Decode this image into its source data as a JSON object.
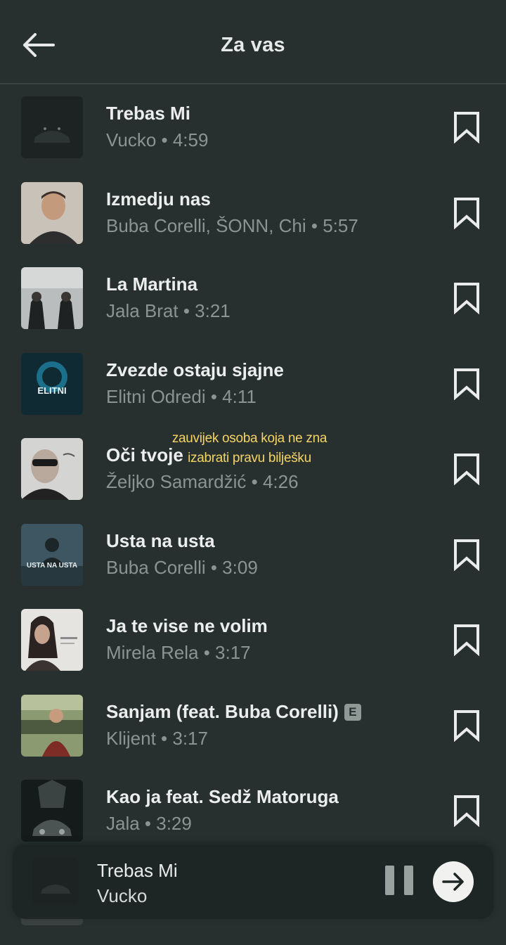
{
  "header": {
    "title": "Za vas"
  },
  "songs": [
    {
      "title": "Trebas Mi",
      "subtitle": "Vucko • 4:59",
      "explicit": false
    },
    {
      "title": "Izmedju nas",
      "subtitle": "Buba Corelli, ŠONN, Chi • 5:57",
      "explicit": false
    },
    {
      "title": "La Martina",
      "subtitle": "Jala Brat • 3:21",
      "explicit": false
    },
    {
      "title": "Zvezde ostaju sjajne",
      "subtitle": "Elitni Odredi • 4:11",
      "explicit": false
    },
    {
      "title": "Oči tvoje",
      "subtitle": "Željko Samardžić • 4:26",
      "explicit": false
    },
    {
      "title": "Usta na usta",
      "subtitle": "Buba Corelli • 3:09",
      "explicit": false
    },
    {
      "title": "Ja te vise ne volim",
      "subtitle": "Mirela Rela • 3:17",
      "explicit": false
    },
    {
      "title": "Sanjam (feat. Buba Corelli)",
      "subtitle": "Klijent • 3:17",
      "explicit": true
    },
    {
      "title": "Kao ja feat. Sedž Matoruga",
      "subtitle": "Jala • 3:29",
      "explicit": false
    }
  ],
  "explicit_label": "E",
  "overlay": {
    "line1": "zauvijek osoba koja ne zna",
    "line2": "izabrati pravu bilješku"
  },
  "player": {
    "title": "Trebas Mi",
    "artist": "Vucko"
  },
  "thumb_texts": {
    "elitni": "ELITNI",
    "usta": "USTA NA USTA"
  },
  "colors": {
    "background": "#27302f",
    "player_background": "#1e2625",
    "overlay_text": "#f4d463",
    "subtitle": "#8a9491"
  },
  "icons": {
    "back": "arrow-left-icon",
    "bookmark": "bookmark-icon",
    "pause": "pause-icon",
    "next": "arrow-right-icon"
  }
}
